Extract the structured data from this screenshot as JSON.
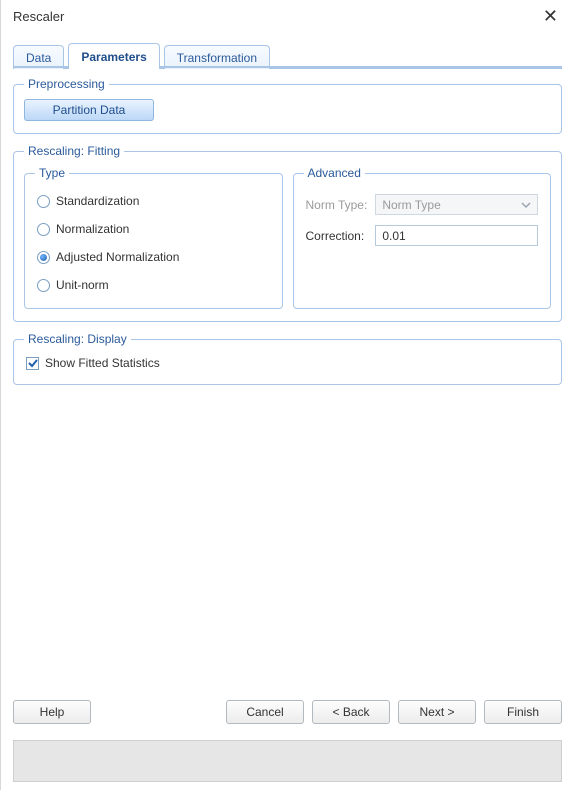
{
  "window": {
    "title": "Rescaler"
  },
  "tabs": {
    "data": "Data",
    "parameters": "Parameters",
    "transformation": "Transformation",
    "active": "parameters"
  },
  "preprocessing": {
    "legend": "Preprocessing",
    "partition_label": "Partition Data"
  },
  "fitting": {
    "legend": "Rescaling: Fitting",
    "type": {
      "legend": "Type",
      "options": {
        "standardization": "Standardization",
        "normalization": "Normalization",
        "adjusted": "Adjusted Normalization",
        "unitnorm": "Unit-norm"
      },
      "selected": "adjusted"
    },
    "advanced": {
      "legend": "Advanced",
      "norm_type_label": "Norm Type:",
      "norm_type_placeholder": "Norm Type",
      "correction_label": "Correction:",
      "correction_value": "0.01"
    }
  },
  "display": {
    "legend": "Rescaling: Display",
    "show_stats_label": "Show Fitted Statistics",
    "show_stats_checked": true
  },
  "buttons": {
    "help": "Help",
    "cancel": "Cancel",
    "back": "< Back",
    "next": "Next >",
    "finish": "Finish"
  }
}
